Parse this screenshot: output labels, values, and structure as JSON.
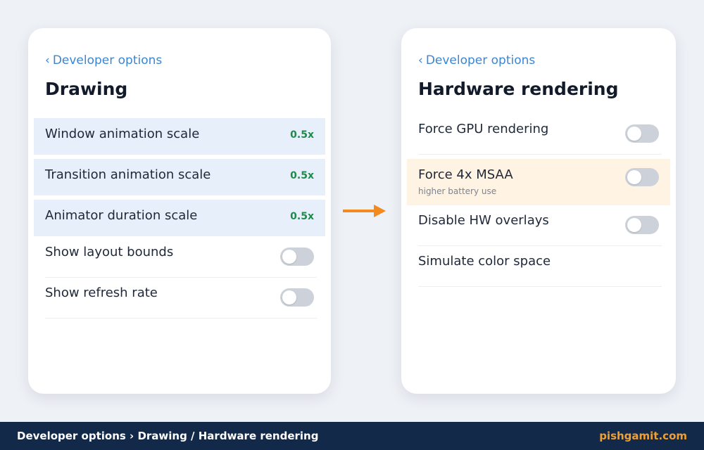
{
  "left_screen": {
    "back_label": "Developer options",
    "title": "Drawing",
    "rows": [
      {
        "label": "Window animation scale",
        "value": "0.5x"
      },
      {
        "label": "Transition animation scale",
        "value": "0.5x"
      },
      {
        "label": "Animator duration scale",
        "value": "0.5x"
      },
      {
        "label": "Show layout bounds",
        "toggle": false
      },
      {
        "label": "Show refresh rate",
        "toggle": false
      }
    ]
  },
  "right_screen": {
    "back_label": "Developer options",
    "title": "Hardware rendering",
    "rows": [
      {
        "label": "Force GPU rendering",
        "toggle": false
      },
      {
        "label": "Force 4x MSAA",
        "sub": "higher battery use",
        "toggle": false
      },
      {
        "label": "Disable HW overlays",
        "toggle": false
      },
      {
        "label": "Simulate color space"
      }
    ]
  },
  "colors": {
    "accent_link": "#3a86d4",
    "value_green": "#1f8a4c",
    "highlight_blue": "#e7effb",
    "highlight_peach": "#fff3e4",
    "arrow_orange": "#f28a1e",
    "footer_bg": "#13294a",
    "brand_orange": "#f0a030"
  },
  "footer": {
    "breadcrumb": "Developer options › Drawing / Hardware rendering",
    "brand": "pishgamit.com"
  }
}
